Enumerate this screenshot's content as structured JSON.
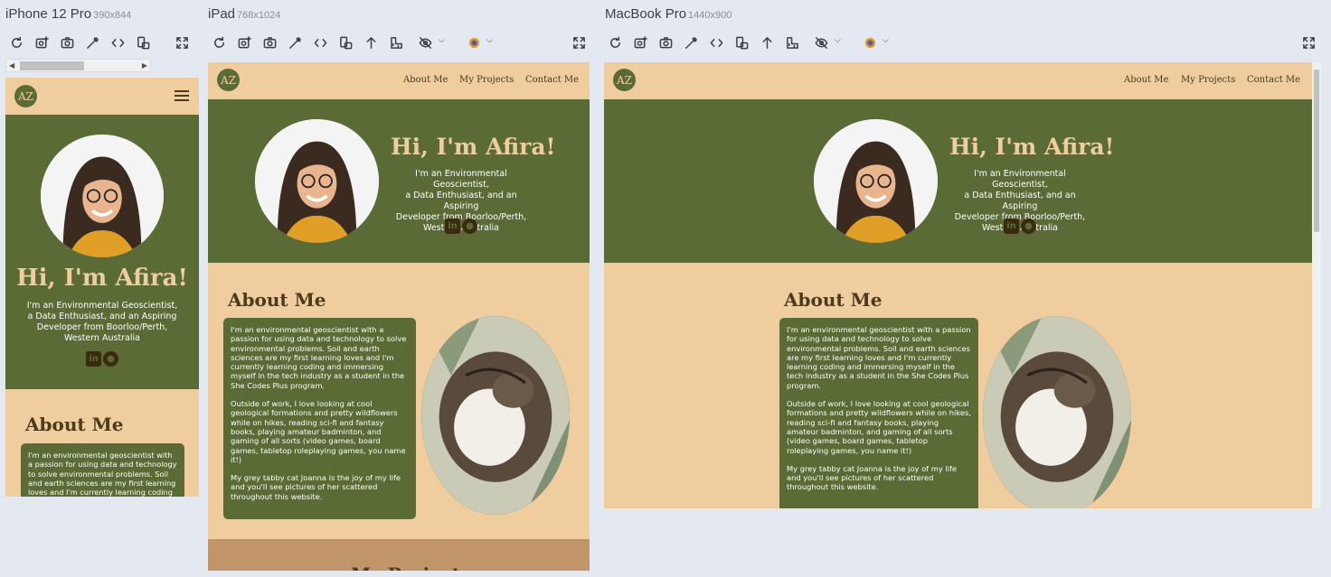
{
  "devices": [
    {
      "name": "iPhone 12 Pro",
      "dims": "390x844"
    },
    {
      "name": "iPad",
      "dims": "768x1024"
    },
    {
      "name": "MacBook Pro",
      "dims": "1440x900"
    }
  ],
  "toolbar_icons": [
    "refresh-icon",
    "screenshot-full-icon",
    "camera-icon",
    "eyedropper-icon",
    "code-icon",
    "rotate-device-icon",
    "scroll-up-icon",
    "ruler-icon",
    "hide-icon",
    "color-filter-icon",
    "fullscreen-icon"
  ],
  "site": {
    "logo": "AZ",
    "nav": [
      "About Me",
      "My Projects",
      "Contact Me"
    ],
    "hero_title": "Hi, I'm Afira!",
    "hero_sub_lines": [
      "I'm an Environmental Geoscientist,",
      "a Data Enthusiast, and an Aspiring",
      "Developer from Boorloo/Perth,",
      "Western Australia"
    ],
    "social": [
      "in",
      "github"
    ],
    "about_title": "About Me",
    "about_paragraphs": [
      "I'm an environmental geoscientist with a passion for using data and technology to solve environmental problems. Soil and earth sciences are my first learning loves and I'm currently learning coding and immersing myself in the tech industry as a student in the She Codes Plus program.",
      "Outside of work, I love looking at cool geological formations and pretty wildflowers while on hikes, reading sci-fi and fantasy books, playing amateur badminton, and gaming of all sorts (video games, board games, tabletop roleplaying games, you name it!)",
      "My grey tabby cat Joanna is the joy of my life and you'll see pictures of her scattered throughout this website."
    ],
    "projects_title": "My Projects"
  },
  "colors": {
    "olive": "#5b6b35",
    "sand": "#efcd9e",
    "tan": "#c0956a",
    "brown": "#4b3a1c"
  }
}
